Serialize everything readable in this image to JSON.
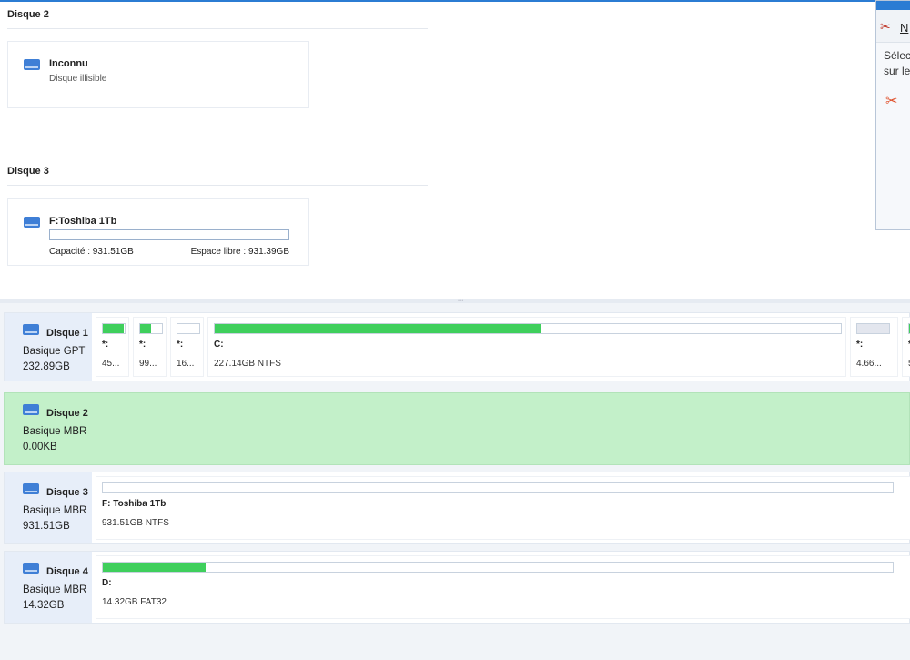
{
  "top": {
    "sections": [
      {
        "title": "Disque 2",
        "card": {
          "name": "Inconnu",
          "sub": "Disque illisible"
        }
      },
      {
        "title": "Disque 3",
        "card": {
          "name": "F:Toshiba 1Tb",
          "capacity": "Capacité : 931.51GB",
          "free": "Espace libre : 931.39GB",
          "used_fraction": 0.0
        }
      }
    ]
  },
  "popup": {
    "new_label": "N",
    "text1": "Sélec",
    "text2": "sur le"
  },
  "disks": [
    {
      "name": "Disque 1",
      "type": "Basique GPT",
      "size": "232.89GB",
      "partitions": [
        {
          "label": "*:",
          "size": "45...",
          "fill": 0.95
        },
        {
          "label": "*:",
          "size": "99...",
          "fill": 0.5
        },
        {
          "label": "*:",
          "size": "16...",
          "fill": 0
        },
        {
          "label": "C:",
          "size": "227.14GB NTFS",
          "fill": 0.52
        },
        {
          "label": "*:",
          "size": "4.66...",
          "fill": 0
        },
        {
          "label": "*",
          "size": "5",
          "fill": 1
        }
      ]
    },
    {
      "name": "Disque 2",
      "type": "Basique MBR",
      "size": "0.00KB",
      "partitions": []
    },
    {
      "name": "Disque 3",
      "type": "Basique MBR",
      "size": "931.51GB",
      "partitions": [
        {
          "label": "F: Toshiba 1Tb",
          "size": "931.51GB NTFS",
          "fill": 0
        }
      ]
    },
    {
      "name": "Disque 4",
      "type": "Basique MBR",
      "size": "14.32GB",
      "partitions": [
        {
          "label": "D:",
          "size": "14.32GB FAT32",
          "fill": 0.13
        }
      ]
    }
  ],
  "colors": {
    "accent": "#2b7cd3",
    "used": "#3fcf5c",
    "selected_row": "#c3f0c9"
  }
}
